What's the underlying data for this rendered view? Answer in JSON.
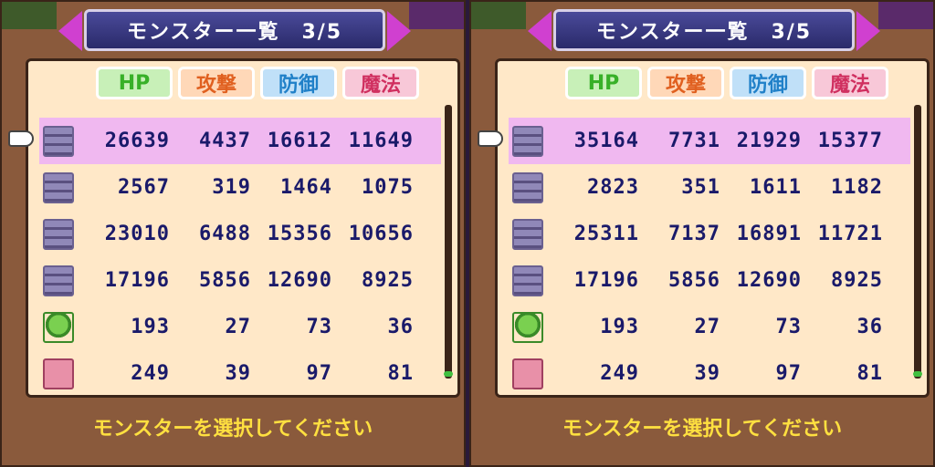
{
  "colors": {
    "frame": "#8a5a3c",
    "panel": "#ffe8c8",
    "selected_row": "#f0b8f0",
    "number": "#1a1a6a",
    "prompt": "#ffe040"
  },
  "headers": {
    "hp": "HP",
    "attack": "攻撃",
    "defense": "防御",
    "magic": "魔法"
  },
  "panels": [
    {
      "title": "モンスター一覧　3/5",
      "prompt": "モンスターを選択してください",
      "rows": [
        {
          "icon": "golem-icon",
          "hp": "26639",
          "atk": "4437",
          "def": "16612",
          "mag": "11649",
          "selected": true
        },
        {
          "icon": "golem-icon",
          "hp": "2567",
          "atk": "319",
          "def": "1464",
          "mag": "1075"
        },
        {
          "icon": "golem-icon",
          "hp": "23010",
          "atk": "6488",
          "def": "15356",
          "mag": "10656"
        },
        {
          "icon": "golem-icon",
          "hp": "17196",
          "atk": "5856",
          "def": "12690",
          "mag": "8925"
        },
        {
          "icon": "plant-icon",
          "hp": "193",
          "atk": "27",
          "def": "73",
          "mag": "36"
        },
        {
          "icon": "block-icon",
          "hp": "249",
          "atk": "39",
          "def": "97",
          "mag": "81"
        }
      ]
    },
    {
      "title": "モンスター一覧　3/5",
      "prompt": "モンスターを選択してください",
      "rows": [
        {
          "icon": "golem-icon",
          "hp": "35164",
          "atk": "7731",
          "def": "21929",
          "mag": "15377",
          "selected": true
        },
        {
          "icon": "golem-icon",
          "hp": "2823",
          "atk": "351",
          "def": "1611",
          "mag": "1182"
        },
        {
          "icon": "golem-icon",
          "hp": "25311",
          "atk": "7137",
          "def": "16891",
          "mag": "11721"
        },
        {
          "icon": "golem-icon",
          "hp": "17196",
          "atk": "5856",
          "def": "12690",
          "mag": "8925"
        },
        {
          "icon": "plant-icon",
          "hp": "193",
          "atk": "27",
          "def": "73",
          "mag": "36"
        },
        {
          "icon": "block-icon",
          "hp": "249",
          "atk": "39",
          "def": "97",
          "mag": "81"
        }
      ]
    }
  ]
}
